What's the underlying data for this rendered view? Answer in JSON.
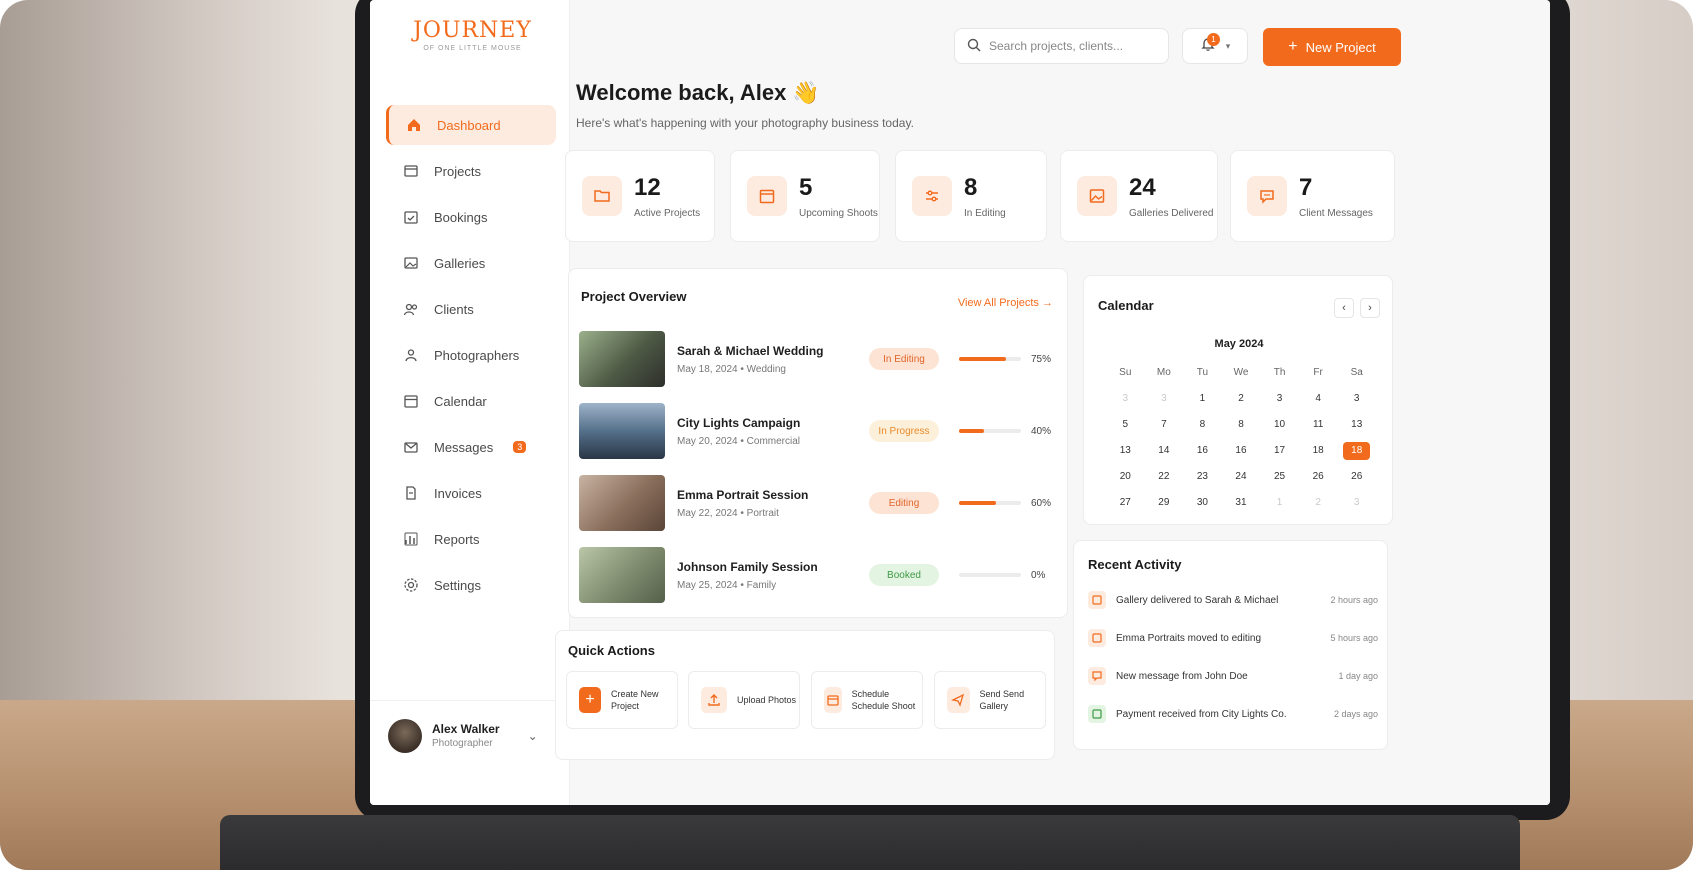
{
  "brand": {
    "title": "JOURNEY",
    "subtitle": "OF ONE LITTLE MOUSE"
  },
  "sidebar": {
    "items": [
      {
        "label": "Dashboard",
        "icon": "home-icon",
        "active": true
      },
      {
        "label": "Projects",
        "icon": "folder-icon"
      },
      {
        "label": "Bookings",
        "icon": "calendar-check-icon"
      },
      {
        "label": "Galleries",
        "icon": "image-icon"
      },
      {
        "label": "Clients",
        "icon": "users-icon"
      },
      {
        "label": "Photographers",
        "icon": "people-icon"
      },
      {
        "label": "Calendar",
        "icon": "calendar-icon"
      },
      {
        "label": "Messages",
        "icon": "mail-icon",
        "badge": "3"
      },
      {
        "label": "Invoices",
        "icon": "invoice-icon"
      },
      {
        "label": "Reports",
        "icon": "chart-icon"
      },
      {
        "label": "Settings",
        "icon": "gear-icon"
      }
    ]
  },
  "user": {
    "name": "Alex Walker",
    "role": "Photographer"
  },
  "topbar": {
    "search_placeholder": "Search projects, clients...",
    "notification_count": "1",
    "new_project_label": "New Project"
  },
  "welcome": {
    "title": "Welcome back, Alex 👋",
    "subtitle": "Here's what's happening with your photography business today."
  },
  "stats": [
    {
      "value": "12",
      "label": "Active Projects",
      "icon": "folder-icon"
    },
    {
      "value": "5",
      "label": "Upcoming Shoots",
      "icon": "calendar-icon"
    },
    {
      "value": "8",
      "label": "In Editing",
      "icon": "sliders-icon"
    },
    {
      "value": "24",
      "label": "Galleries Delivered",
      "icon": "image-icon"
    },
    {
      "value": "7",
      "label": "Client Messages",
      "icon": "chat-icon"
    }
  ],
  "overview": {
    "title": "Project Overview",
    "view_all": "View All Projects",
    "projects": [
      {
        "name": "Sarah & Michael Wedding",
        "date": "May 18, 2024",
        "type": "Wedding",
        "status": "In Editing",
        "progress": 75,
        "progress_label": "75%"
      },
      {
        "name": "City Lights Campaign",
        "date": "May 20, 2024",
        "type": "Commercial",
        "status": "In Progress",
        "progress": 40,
        "progress_label": "40%"
      },
      {
        "name": "Emma Portrait Session",
        "date": "May 22, 2024",
        "type": "Portrait",
        "status": "Editing",
        "progress": 60,
        "progress_label": "60%"
      },
      {
        "name": "Johnson Family Session",
        "date": "May 25, 2024",
        "type": "Family",
        "status": "Booked",
        "progress": 0,
        "progress_label": "0%"
      }
    ]
  },
  "calendar": {
    "title": "Calendar",
    "month": "May 2024",
    "weekdays": [
      "Su",
      "Mo",
      "Tu",
      "We",
      "Th",
      "Fr",
      "Sa"
    ],
    "days": [
      "3",
      "3",
      "1",
      "2",
      "3",
      "4",
      "3",
      "5",
      "7",
      "8",
      "8",
      "10",
      "11",
      "13",
      "13",
      "14",
      "16",
      "16",
      "17",
      "18",
      "18",
      "20",
      "22",
      "23",
      "24",
      "25",
      "26",
      "26",
      "27",
      "29",
      "30",
      "31",
      "1",
      "2",
      "3"
    ],
    "muted_indices": [
      0,
      1,
      32,
      33,
      34
    ],
    "selected_index": 20
  },
  "activity": {
    "title": "Recent Activity",
    "items": [
      {
        "text": "Gallery delivered to Sarah & Michael",
        "time": "2 hours ago"
      },
      {
        "text": "Emma Portraits moved to editing",
        "time": "5 hours ago"
      },
      {
        "text": "New message from John Doe",
        "time": "1 day ago"
      },
      {
        "text": "Payment received from City Lights Co.",
        "time": "2 days ago"
      }
    ]
  },
  "quick": {
    "title": "Quick Actions",
    "actions": [
      {
        "label": "Create New Project",
        "icon": "plus-icon"
      },
      {
        "label": "Upload Photos",
        "icon": "upload-icon"
      },
      {
        "label": "Schedule Schedule Shoot",
        "icon": "calendar-icon"
      },
      {
        "label": "Send Send Gallery",
        "icon": "send-icon"
      }
    ]
  },
  "colors": {
    "accent": "#f26b1d",
    "accent_soft": "#fdebe0"
  }
}
